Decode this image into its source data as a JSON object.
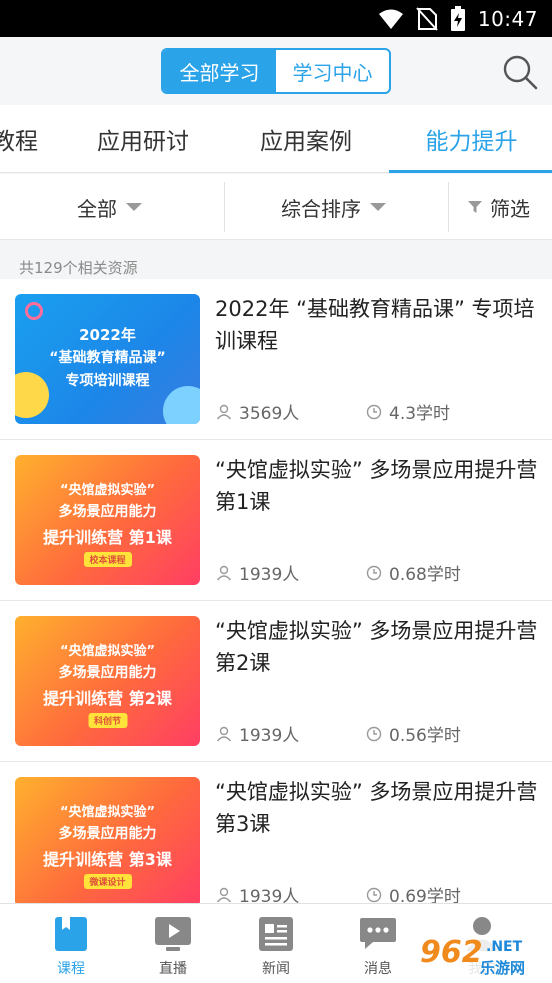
{
  "status_bar": {
    "time": "10:47"
  },
  "header": {
    "segments": [
      {
        "label": "全部学习",
        "active": true
      },
      {
        "label": "学习中心",
        "active": false
      }
    ],
    "search_icon": "search-icon"
  },
  "category_tabs": [
    {
      "label": "教程",
      "active": false
    },
    {
      "label": "应用研讨",
      "active": false
    },
    {
      "label": "应用案例",
      "active": false
    },
    {
      "label": "能力提升",
      "active": true
    }
  ],
  "filters": {
    "all": "全部",
    "sort": "综合排序",
    "screen": "筛选"
  },
  "result_count": "共129个相关资源",
  "courses": [
    {
      "title": "2022年 “基础教育精品课” 专项培训课程",
      "learners": "3569人",
      "hours": "4.3学时",
      "thumb": {
        "lines": [
          "2022年",
          "“基础教育精品课”",
          "专项培训课程"
        ],
        "tag": ""
      }
    },
    {
      "title": "“央馆虚拟实验” 多场景应用提升营 第1课",
      "learners": "1939人",
      "hours": "0.68学时",
      "thumb": {
        "lines": [
          "“央馆虚拟实验”",
          "多场景应用能力",
          "提升训练营 第1课"
        ],
        "tag": "校本课程"
      }
    },
    {
      "title": "“央馆虚拟实验” 多场景应用提升营 第2课",
      "learners": "1939人",
      "hours": "0.56学时",
      "thumb": {
        "lines": [
          "“央馆虚拟实验”",
          "多场景应用能力",
          "提升训练营 第2课"
        ],
        "tag": "科创节"
      }
    },
    {
      "title": "“央馆虚拟实验” 多场景应用提升营 第3课",
      "learners": "1939人",
      "hours": "0.69学时",
      "thumb": {
        "lines": [
          "“央馆虚拟实验”",
          "多场景应用能力",
          "提升训练营 第3课"
        ],
        "tag": "微课设计"
      }
    }
  ],
  "bottom_nav": [
    {
      "label": "课程",
      "icon": "book-icon",
      "active": true
    },
    {
      "label": "直播",
      "icon": "live-play-icon",
      "active": false
    },
    {
      "label": "新闻",
      "icon": "news-icon",
      "active": false
    },
    {
      "label": "消息",
      "icon": "message-icon",
      "active": false
    },
    {
      "label": "我的",
      "icon": "user-icon",
      "active": false
    }
  ],
  "watermark": {
    "number": "962",
    "domain": ".NET",
    "site_name": "乐游网"
  },
  "colors": {
    "accent": "#2aa3e8",
    "status_bar": "#000000",
    "thumb_blue": "#1c86e8",
    "thumb_orange": "#ff6a3d"
  }
}
